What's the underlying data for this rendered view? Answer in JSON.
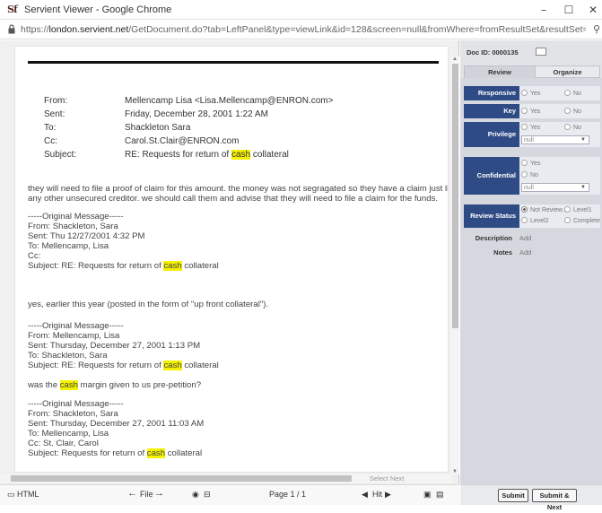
{
  "window": {
    "logo": "Sf",
    "title": "Servient Viewer - Google Chrome",
    "url_prefix": "https://",
    "url_host": "london.servient.net",
    "url_path": "/GetDocument.do?tab=LeftPanel&type=viewLink&id=128&screen=null&fromWhere=fromResultSet&resultSet=fromSear..."
  },
  "document": {
    "headers": [
      {
        "label": "From:",
        "value": "Mellencamp Lisa <Lisa.Mellencamp@ENRON.com>"
      },
      {
        "label": "Sent:",
        "value": "Friday, December 28, 2001 1:22 AM"
      },
      {
        "label": "To:",
        "value": "Shackleton Sara"
      },
      {
        "label": "Cc:",
        "value": "Carol.St.Clair@ENRON.com"
      },
      {
        "label": "Subject:",
        "value_pre": "RE: Requests for return of ",
        "value_hl": "cash",
        "value_post": " collateral"
      }
    ],
    "body1": [
      "they will need to file a proof of claim for this amount. the money was not segragated so they have a claim just like",
      "any other unsecured creditor. we should call them and advise that they will need to file a claim for the funds."
    ],
    "orig1": [
      "-----Original Message-----",
      "From: Shackleton, Sara",
      "Sent: Thu 12/27/2001 4:32 PM",
      "To: Mellencamp, Lisa",
      "Cc:"
    ],
    "orig1_subject_pre": "Subject: RE: Requests for return of ",
    "orig1_subject_post": " collateral",
    "body2": "yes, earlier this year (posted in the form of \"up front collateral\").",
    "orig2": [
      "-----Original Message-----",
      "From: Mellencamp, Lisa",
      "Sent: Thursday, December 27, 2001 1:13 PM",
      "To: Shackleton, Sara"
    ],
    "orig2_subject_pre": "Subject: RE: Requests for return of ",
    "orig2_subject_post": " collateral",
    "body3_pre": "was the ",
    "body3_post": " margin given to us pre-petition?",
    "orig3": [
      "-----Original Message-----",
      "From: Shackleton, Sara",
      "Sent: Thursday, December 27, 2001 11:03 AM",
      "To: Mellencamp, Lisa",
      "Cc: St. Clair, Carol"
    ],
    "orig3_subject_pre": "Subject: Requests for return of ",
    "orig3_subject_post": " collateral",
    "highlight_word": "cash",
    "select_next": "Select Next"
  },
  "toolbar": {
    "html_label": "HTML",
    "file_label": "File",
    "page_label": "Page 1 / 1",
    "hit_label": "Hit"
  },
  "review": {
    "doc_id": "Doc ID: 0000135",
    "tab_review": "Review",
    "tab_organize": "Organize",
    "responsive_label": "Responsive",
    "key_label": "Key",
    "privilege_label": "Privilege",
    "confidential_label": "Confidential",
    "review_status_label": "Review Status",
    "yes": "Yes",
    "no": "No",
    "privilege_select": "null",
    "confidential_select": "null",
    "status_not_reviewed": "Not Review...",
    "status_level1": "Level1",
    "status_level2": "Level2",
    "status_complete": "Complete",
    "description_label": "Description",
    "notes_label": "Notes",
    "add": "Add",
    "submit": "Submit",
    "submit_next": "Submit & Next"
  },
  "colors": {
    "field_label_bg": "#2f4b86",
    "highlight": "#f5f200"
  }
}
